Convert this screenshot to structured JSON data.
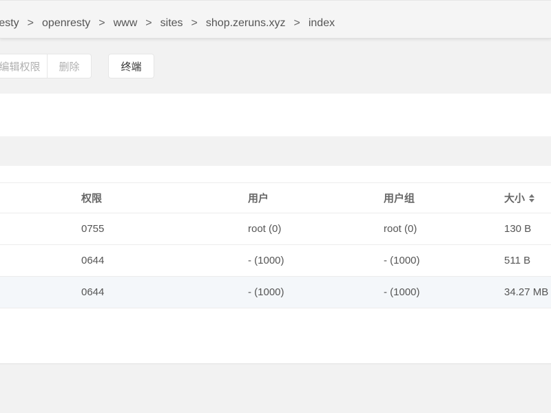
{
  "breadcrumb": {
    "segments": [
      "resty",
      "openresty",
      "www",
      "sites",
      "shop.zeruns.xyz",
      "index"
    ],
    "separator": ">"
  },
  "toolbar": {
    "edit_permissions_label": "编辑权限",
    "delete_label": "删除",
    "terminal_label": "终端"
  },
  "table": {
    "headers": {
      "permissions": "权限",
      "user": "用户",
      "group": "用户组",
      "size": "大小"
    },
    "rows": [
      {
        "permissions": "0755",
        "user": "root (0)",
        "group": "root (0)",
        "size": "130 B"
      },
      {
        "permissions": "0644",
        "user": "- (1000)",
        "group": "- (1000)",
        "size": "511 B"
      },
      {
        "permissions": "0644",
        "user": "- (1000)",
        "group": "- (1000)",
        "size": "34.27 MB"
      }
    ]
  }
}
